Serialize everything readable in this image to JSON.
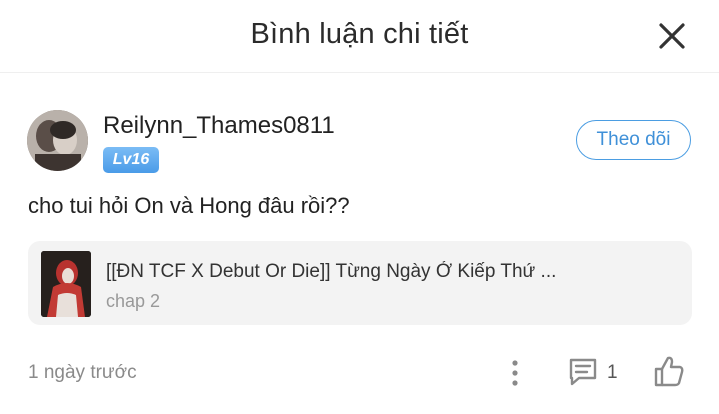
{
  "header": {
    "title": "Bình luận chi tiết",
    "close_icon": "close-icon"
  },
  "comment": {
    "username": "Reilynn_Thames0811",
    "level": "Lv16",
    "follow_label": "Theo dõi",
    "text": "cho tui hỏi On và Hong đâu rồi??",
    "story": {
      "title": "[[ĐN TCF X Debut Or Die]] Từng Ngày Ở Kiếp Thứ ...",
      "chapter": "chap 2"
    },
    "time": "1 ngày trước",
    "reply_count": "1"
  },
  "colors": {
    "accent": "#4b9de2",
    "badge": "#5aa7ec",
    "card_bg": "#f3f3f3",
    "muted": "#8a8a8a"
  },
  "icons": {
    "close": "close-icon",
    "more": "more-vertical-icon",
    "reply": "comment-icon",
    "like": "thumbs-up-icon"
  }
}
